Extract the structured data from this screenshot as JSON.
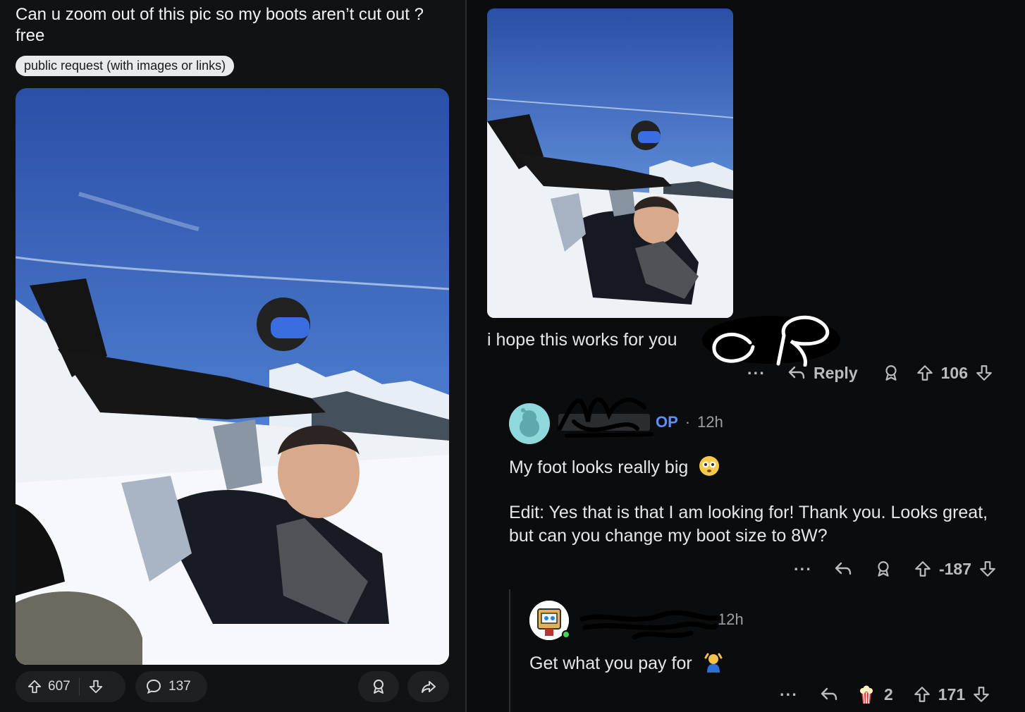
{
  "post": {
    "title": "Can u zoom out of this pic so my boots aren’t cut out ? free",
    "flair": "public request (with images or links)",
    "upvotes": "607",
    "comments": "137"
  },
  "comments": [
    {
      "text": "i hope this works for you",
      "reply_label": "Reply",
      "votes": "106"
    },
    {
      "author_suffix": "OP",
      "separator": "·",
      "timestamp": "12h",
      "text": "My foot looks really big",
      "edit_text": "Edit: Yes that is that I am looking for! Thank you. Looks great, but can you change my boot size to 8W?",
      "votes": "-187"
    },
    {
      "timestamp": "12h",
      "text": "Get what you pay for",
      "award_count": "2",
      "votes": "171"
    }
  ],
  "colors": {
    "background": "#0b0c0d",
    "panel": "#111213",
    "op_blue": "#5d8fff",
    "flair_bg": "#e9eaeb"
  }
}
